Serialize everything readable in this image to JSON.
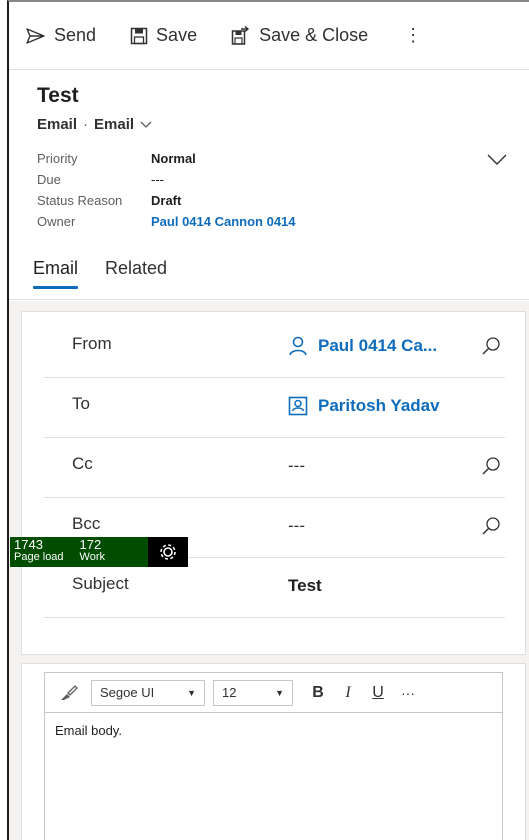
{
  "toolbar": {
    "send_label": "Send",
    "save_label": "Save",
    "save_close_label": "Save & Close",
    "more_label": "⋮"
  },
  "header": {
    "title": "Test",
    "entity": "Email",
    "separator": "·",
    "form": "Email",
    "fields": [
      {
        "label": "Priority",
        "value": "Normal"
      },
      {
        "label": "Due",
        "value": "---"
      },
      {
        "label": "Status Reason",
        "value": "Draft"
      },
      {
        "label": "Owner",
        "value": "Paul 0414 Cannon 0414"
      }
    ],
    "tabs": [
      {
        "label": "Email",
        "active": true
      },
      {
        "label": "Related",
        "active": false
      }
    ]
  },
  "form": {
    "rows": [
      {
        "label": "From",
        "value": "Paul 0414 Ca...",
        "type": "lookup-user"
      },
      {
        "label": "To",
        "value": "Paritosh Yadav",
        "type": "lookup-contact"
      },
      {
        "label": "Cc",
        "value": "---",
        "type": "lookup-empty"
      },
      {
        "label": "Bcc",
        "value": "---",
        "type": "lookup-empty"
      },
      {
        "label": "Subject",
        "value": "Test",
        "type": "text"
      }
    ]
  },
  "editor": {
    "font": "Segoe UI",
    "size": "12",
    "bold": "B",
    "italic": "I",
    "underline": "U",
    "more": "···",
    "body": "Email body."
  },
  "perf": {
    "page_load_value": "1743",
    "page_load_label": "Page load",
    "work_value": "172",
    "work_label": "Work"
  },
  "colors": {
    "accent": "#0f6cbd",
    "perf_bg": "#004d00"
  }
}
